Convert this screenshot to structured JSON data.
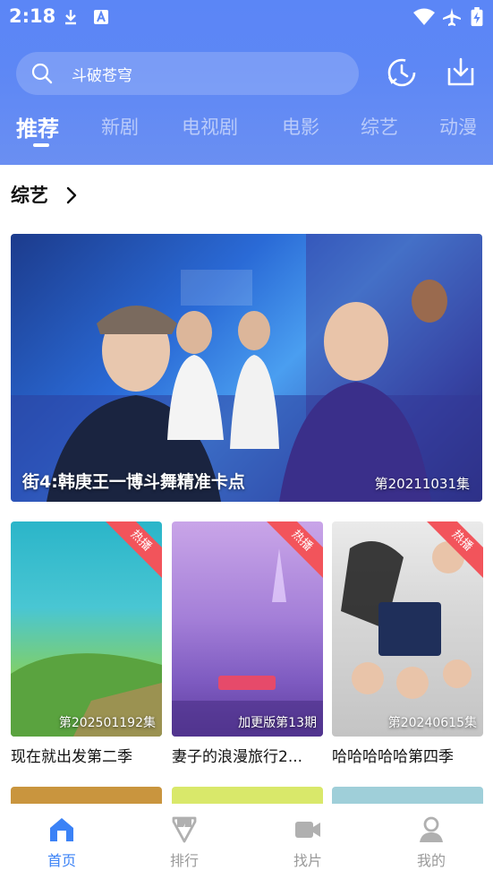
{
  "status_bar": {
    "time": "2:18"
  },
  "search": {
    "placeholder_text": "斗破苍穹"
  },
  "tabs": [
    {
      "label": "推荐",
      "active": true
    },
    {
      "label": "新剧"
    },
    {
      "label": "电视剧"
    },
    {
      "label": "电影"
    },
    {
      "label": "综艺"
    },
    {
      "label": "动漫"
    }
  ],
  "section": {
    "title": "综艺"
  },
  "hero": {
    "title": "街4:韩庚王一博斗舞精准卡点",
    "episode": "第20211031集"
  },
  "cards": [
    {
      "badge": "热播",
      "episode": "第202501192集",
      "title": "现在就出发第二季"
    },
    {
      "badge": "热播",
      "episode": "加更版第13期",
      "title": "妻子的浪漫旅行2..."
    },
    {
      "badge": "热播",
      "episode": "第20240615集",
      "title": "哈哈哈哈哈第四季"
    }
  ],
  "bottom_nav": [
    {
      "label": "首页",
      "icon": "home-icon",
      "active": true
    },
    {
      "label": "排行",
      "icon": "ranking-icon"
    },
    {
      "label": "找片",
      "icon": "video-camera-icon"
    },
    {
      "label": "我的",
      "icon": "user-icon"
    }
  ],
  "colors": {
    "header": "#5b86f6",
    "accent": "#3b82f6",
    "hot_badge": "#f2545b",
    "nav_inactive": "#9a9a9a"
  }
}
